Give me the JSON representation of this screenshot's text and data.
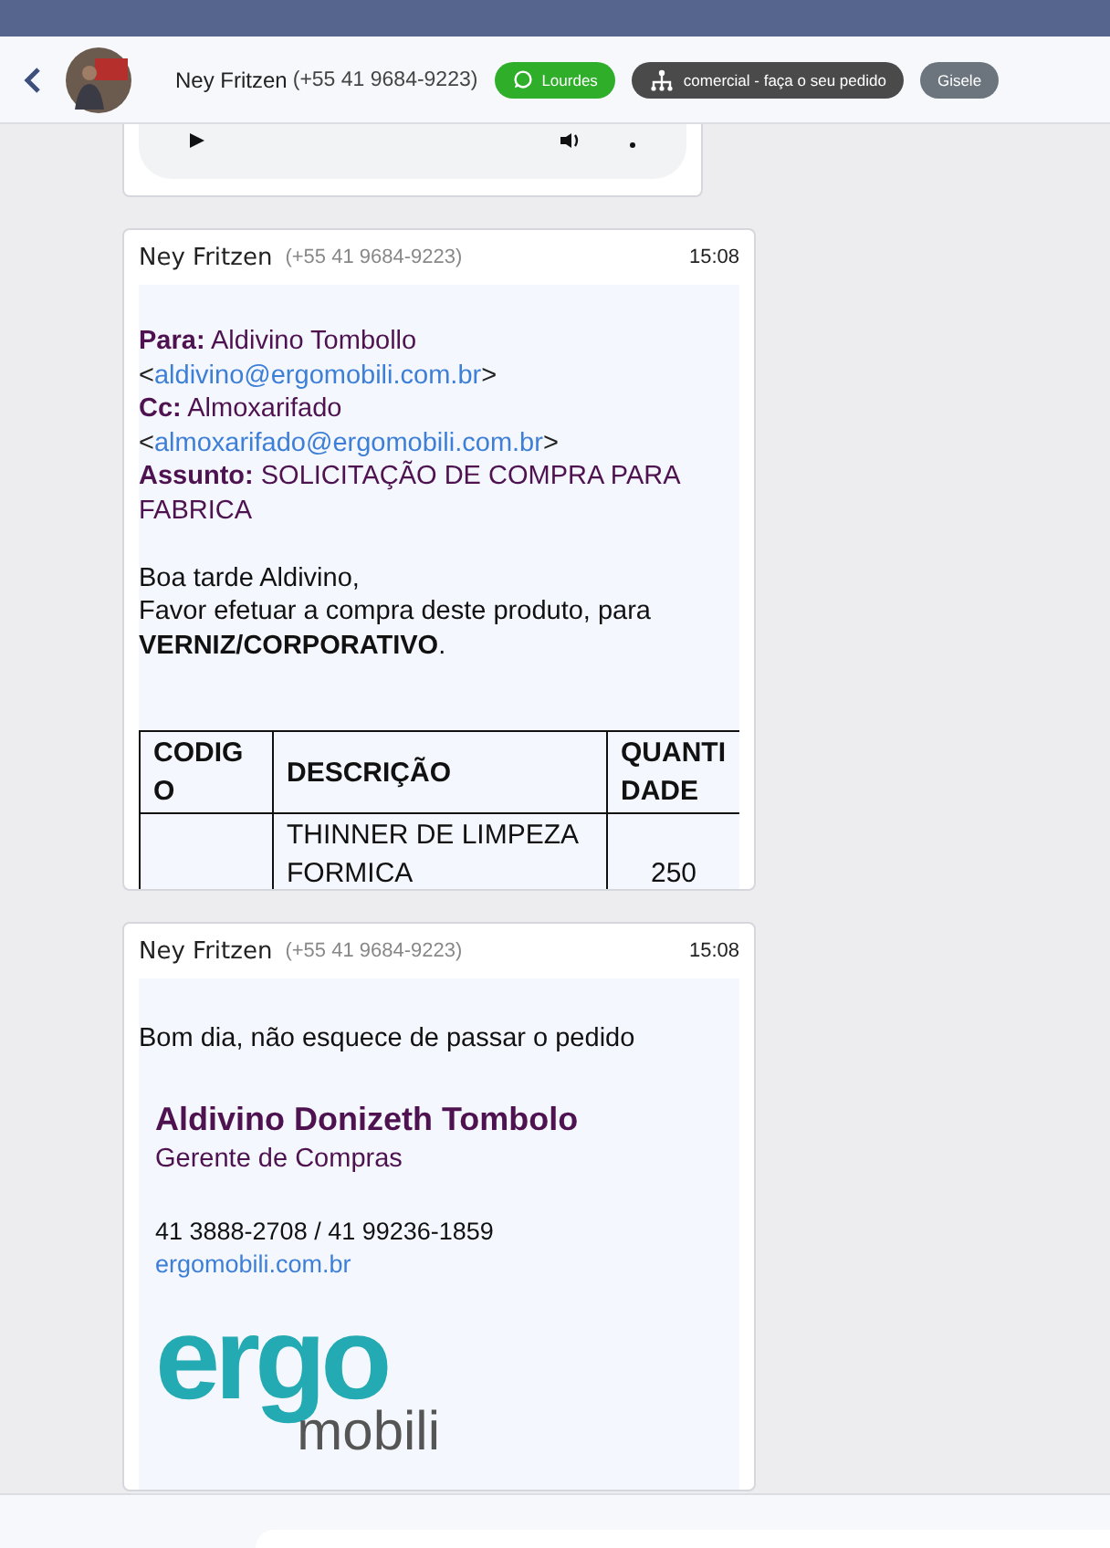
{
  "header": {
    "contact_name": "Ney Fritzen",
    "phone": "(+55 41 9684-9223)",
    "tags": [
      {
        "label": "Lourdes",
        "kind": "whatsapp",
        "color": "#2fae2a"
      },
      {
        "label": "comercial - faça o seu pedido",
        "kind": "flow",
        "color": "#4a4a4a"
      },
      {
        "label": "Gisele",
        "kind": "plain",
        "color": "#6c757d"
      }
    ]
  },
  "messages": [
    {
      "kind": "audio"
    },
    {
      "kind": "email",
      "sender": "Ney Fritzen",
      "phone": "(+55 41 9684-9223)",
      "time": "15:08",
      "fields": [
        {
          "text": "**Para:** Aldivino Tombollo",
          "open": "<",
          "email": "aldivino@ergomobili.com.br",
          "close": ">"
        },
        {
          "text": "**Cc:** Almoxarifado",
          "open": "<",
          "email": "almoxarifado@ergomobili.com.br",
          "close": ">"
        },
        {
          "text": "**Assunto:** SOLICITAÇÃO DE COMPRA PARA FABRICA"
        }
      ],
      "paragraph": [
        "Boa tarde Aldivino,",
        "Favor efetuar a compra deste produto, para **VERNIZ/CORPORATIVO**."
      ],
      "table": {
        "columns": [
          "CODIGO",
          "DESCRIÇÃO",
          "QUANTIDADE"
        ],
        "rows": [
          {
            "description": "THINNER DE LIMPEZA FORMICA",
            "quantity": "250"
          }
        ]
      }
    },
    {
      "kind": "signature",
      "sender": "Ney Fritzen",
      "phone": "(+55 41 9684-9223)",
      "time": "15:08",
      "text": "Bom dia, não esquece de passar o pedido",
      "signature": {
        "name": "Aldivino Donizeth Tombolo",
        "role": "Gerente de Compras",
        "phones": "41 3888-2708 / 41 99236-1859",
        "website": "ergomobili.com.br"
      },
      "logo": {
        "top": "ergo",
        "bottom": "mobili"
      }
    }
  ]
}
